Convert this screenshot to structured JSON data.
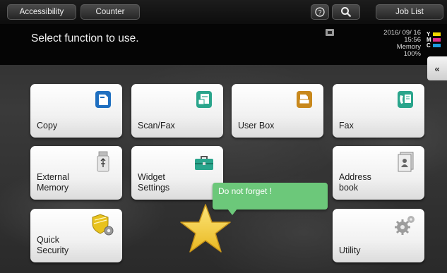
{
  "topbar": {
    "accessibility_label": "Accessibility",
    "counter_label": "Counter",
    "help_icon": "help-icon",
    "search_icon": "search-icon",
    "joblist_label": "Job List"
  },
  "message": "Select function to use.",
  "status": {
    "date": "2016/ 09/ 16",
    "time": "15:56",
    "memory_label": "Memory",
    "memory_value": "100%"
  },
  "toner": [
    {
      "letter": "Y",
      "color": "#f2d900"
    },
    {
      "letter": "M",
      "color": "#e0308a"
    },
    {
      "letter": "C",
      "color": "#1e9ce0"
    }
  ],
  "collapse_label": "«",
  "tiles": {
    "copy": "Copy",
    "scan": "Scan/Fax",
    "userbox": "User Box",
    "fax": "Fax",
    "external_line1": "External",
    "external_line2": "Memory",
    "widget_line1": "Widget",
    "widget_line2": "Settings",
    "address_line1": "Address",
    "address_line2": "book",
    "quick_line1": "Quick",
    "quick_line2": "Security",
    "utility": "Utility"
  },
  "callout": "Do not forget !",
  "colors": {
    "accent_blue": "#1f6fc0",
    "accent_teal": "#2aa58c",
    "accent_orange": "#c8881c",
    "callout_green": "#6cc87a",
    "star_yellow": "#f6d23c"
  }
}
